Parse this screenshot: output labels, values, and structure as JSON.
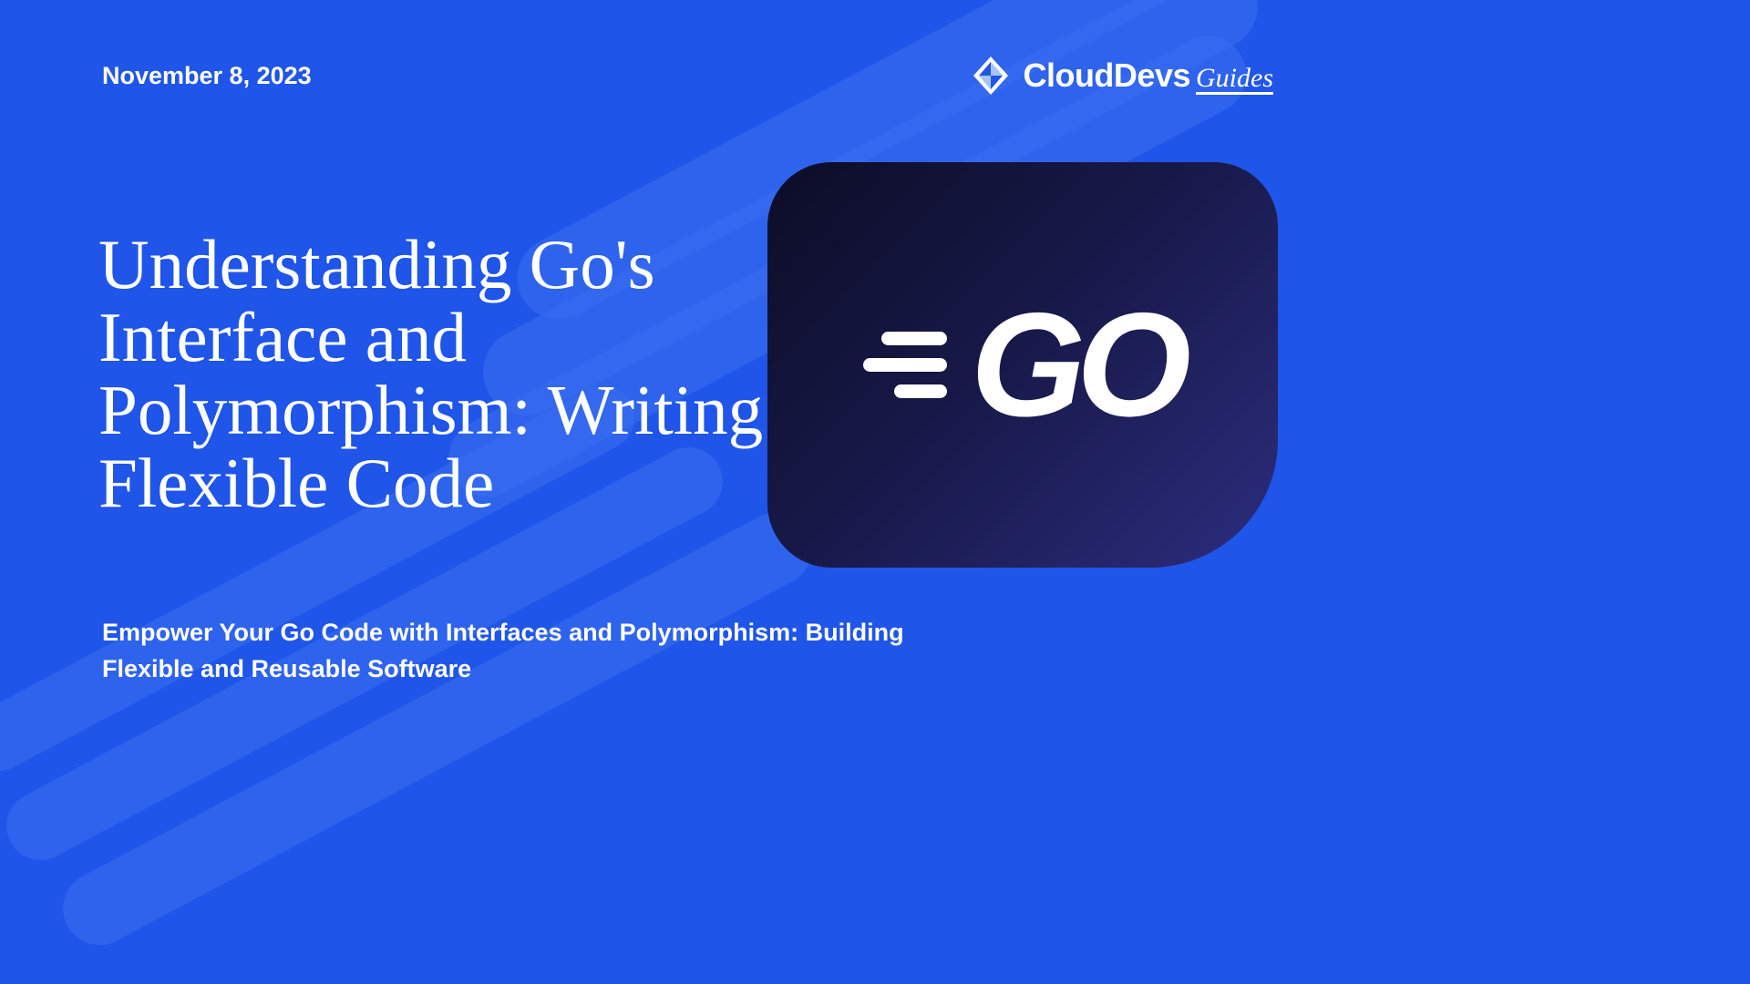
{
  "date": "November 8, 2023",
  "brand": {
    "main": "CloudDevs",
    "sub": "Guides"
  },
  "title": "Understanding Go's Interface and Polymorphism: Writing Flexible Code",
  "subtitle": "Empower Your Go Code with Interfaces and Polymorphism: Building Flexible and Reusable Software",
  "go_logo_text": "GO"
}
